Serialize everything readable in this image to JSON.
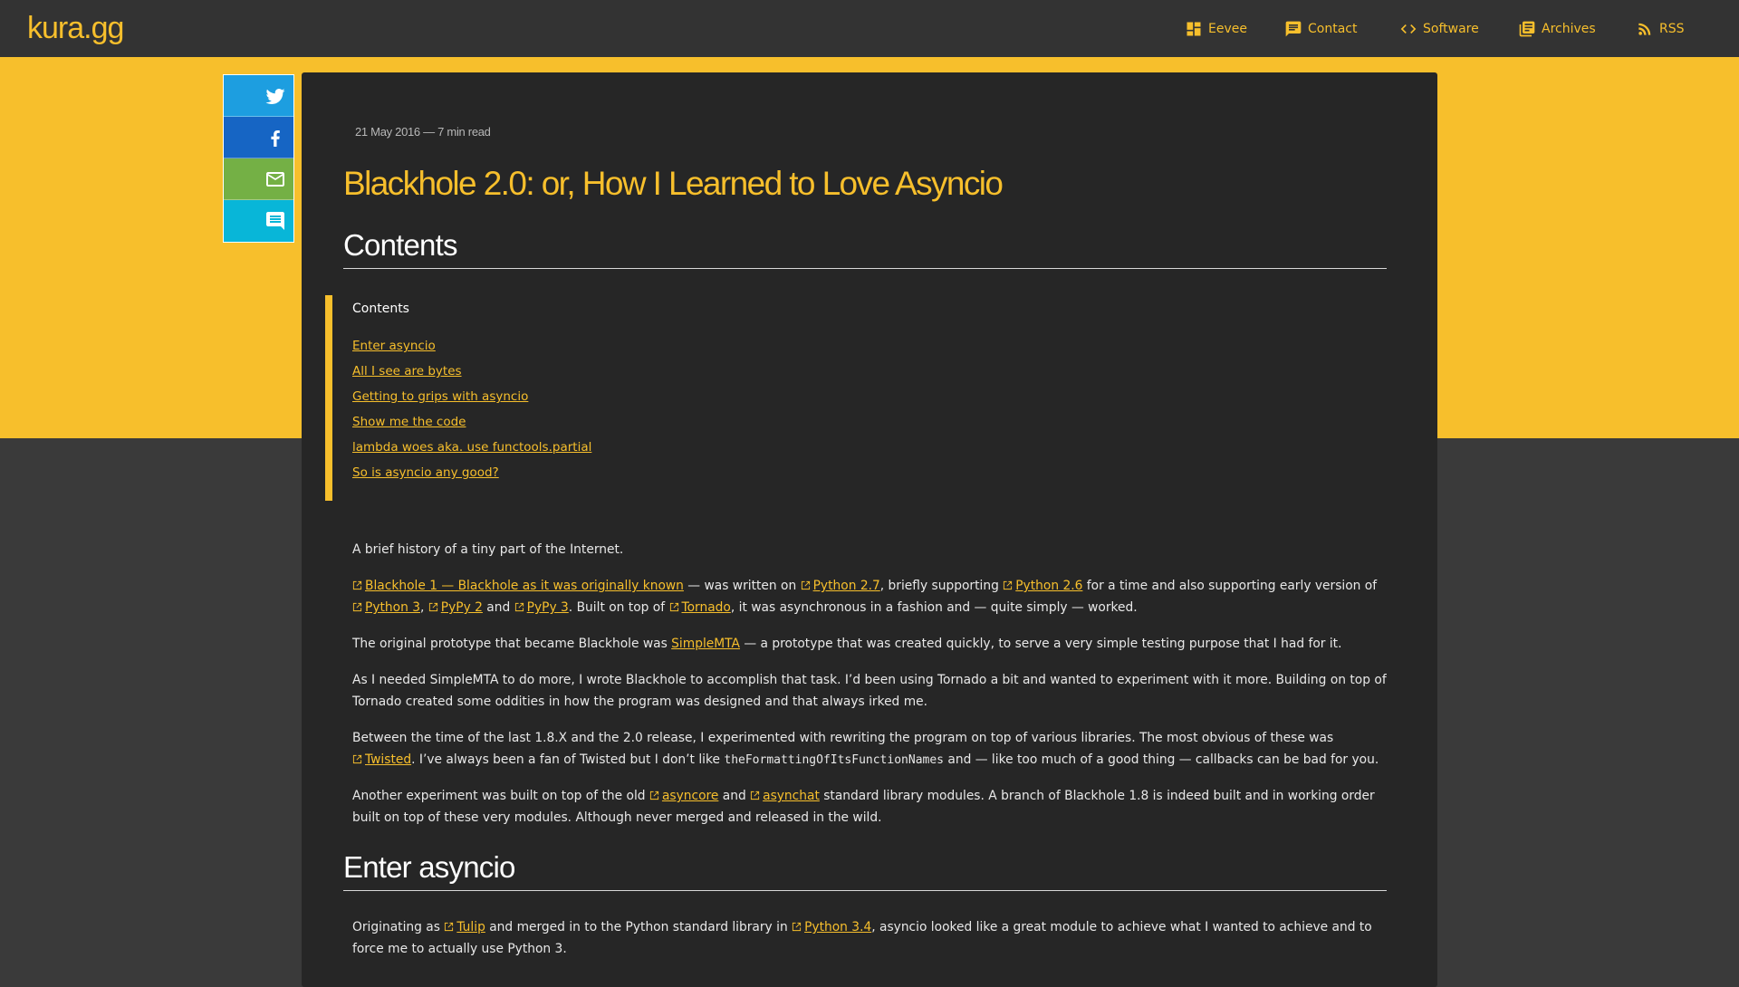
{
  "site": {
    "logo": "kura.gg"
  },
  "nav": [
    {
      "label": "Eevee",
      "icon": "dashboard-icon"
    },
    {
      "label": "Contact",
      "icon": "chat-icon"
    },
    {
      "label": "Software",
      "icon": "code-icon"
    },
    {
      "label": "Archives",
      "icon": "library-icon"
    },
    {
      "label": "RSS",
      "icon": "rss-icon"
    }
  ],
  "share": [
    {
      "name": "twitter",
      "icon": "twitter-icon",
      "color": "#1d9ee0"
    },
    {
      "name": "facebook",
      "icon": "facebook-icon",
      "color": "#1665c4"
    },
    {
      "name": "email",
      "icon": "email-icon",
      "color": "#74b045"
    },
    {
      "name": "comment",
      "icon": "comment-icon",
      "color": "#08b6d8"
    }
  ],
  "colors": {
    "accent": "#f7bf2c",
    "page_bg": "#3a3a3a",
    "card_bg": "#262626",
    "header_bg": "#333333"
  },
  "post": {
    "meta": "21 May 2016 — 7 min read",
    "title": "Blackhole 2.0: or, How I Learned to Love Asyncio",
    "contents_heading": "Contents",
    "toc": {
      "title": "Contents",
      "items": [
        "Enter asyncio",
        "All I see are bytes",
        "Getting to grips with asyncio",
        "Show me the code",
        "lambda woes aka. use functools.partial",
        "So is asyncio any good?"
      ]
    },
    "p1": "A brief history of a tiny part of the Internet.",
    "p2": {
      "link1": "Blackhole 1 — Blackhole as it was originally known",
      "t1": " — was written on ",
      "link2": "Python 2.7",
      "t2": ", briefly supporting ",
      "link3": "Python 2.6",
      "t3": " for a time and also supporting early version of ",
      "link4": "Python 3",
      "t4": ", ",
      "link5": "PyPy 2",
      "t5": " and ",
      "link6": "PyPy 3",
      "t6": ". Built on top of ",
      "link7": "Tornado",
      "t7": ", it was asynchronous in a fashion and — quite simply — worked."
    },
    "p3": {
      "t1": "The original prototype that became Blackhole was ",
      "link1": "SimpleMTA",
      "t2": " — a prototype that was created quickly, to serve a very simple testing purpose that I had for it."
    },
    "p4": "As I needed SimpleMTA to do more, I wrote Blackhole to accomplish that task. I’d been using Tornado a bit and wanted to experiment with it more. Building on top of Tornado created some oddities in how the program was designed and that always irked me.",
    "p5": {
      "t1": "Between the time of the last 1.8.X and the 2.0 release, I experimented with rewriting the program on top of various libraries. The most obvious of these was ",
      "link1": "Twisted",
      "t2": ". I’ve always been a fan of Twisted but I don’t like ",
      "code1": "theFormattingOfItsFunctionNames",
      "t3": " and — like too much of a good thing — callbacks can be bad for you."
    },
    "p6": {
      "t1": "Another experiment was built on top of the old ",
      "link1": "asyncore",
      "t2": " and ",
      "link2": "asynchat",
      "t3": " standard library modules. A branch of Blackhole 1.8 is indeed built and in working order built on top of these very modules. Although never merged and released in the wild."
    },
    "section2_heading": "Enter asyncio",
    "p7": {
      "t1": "Originating as ",
      "link1": "Tulip",
      "t2": " and merged in to the Python standard library in ",
      "link2": "Python 3.4",
      "t3": ", asyncio looked like a great module to achieve what I wanted to achieve and to force me to actually use Python 3."
    }
  }
}
